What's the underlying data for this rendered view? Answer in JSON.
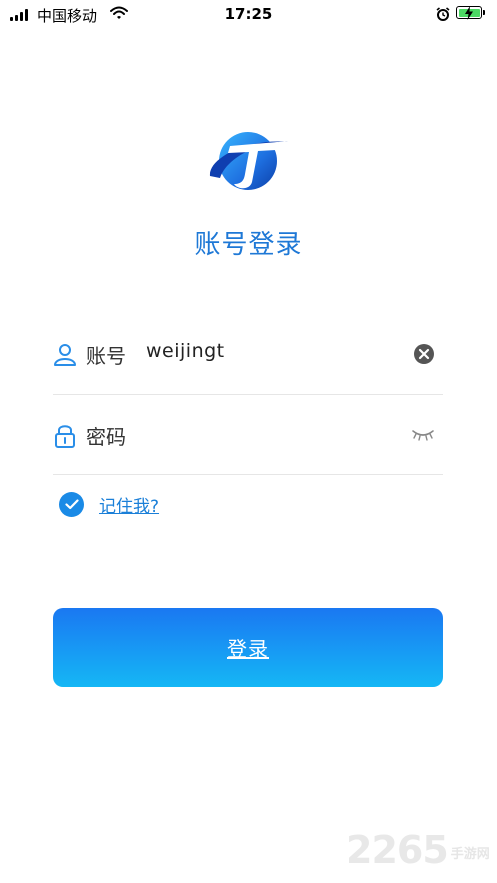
{
  "status_bar": {
    "carrier": "中国移动",
    "time": "17:25",
    "icons": [
      "signal-icon",
      "wifi-icon",
      "alarm-icon",
      "battery-charging-icon"
    ],
    "battery_color": "#4cd964"
  },
  "header": {
    "logo_icon": "app-logo-icon",
    "title": "账号登录"
  },
  "form": {
    "account": {
      "icon": "user-icon",
      "label": "账号",
      "value": "weijingt",
      "clear_icon": "clear-icon"
    },
    "password": {
      "icon": "lock-icon",
      "label": "密码",
      "value": "",
      "toggle_icon": "eye-closed-icon"
    },
    "remember": {
      "checked": true,
      "label": "记住我?"
    }
  },
  "login_button": {
    "label": "登录"
  },
  "watermark": {
    "number": "2265",
    "site": "手游网"
  },
  "colors": {
    "accent": "#1e78d6",
    "button_gradient_top": "#1a78f2",
    "button_gradient_bottom": "#15b7f5"
  }
}
